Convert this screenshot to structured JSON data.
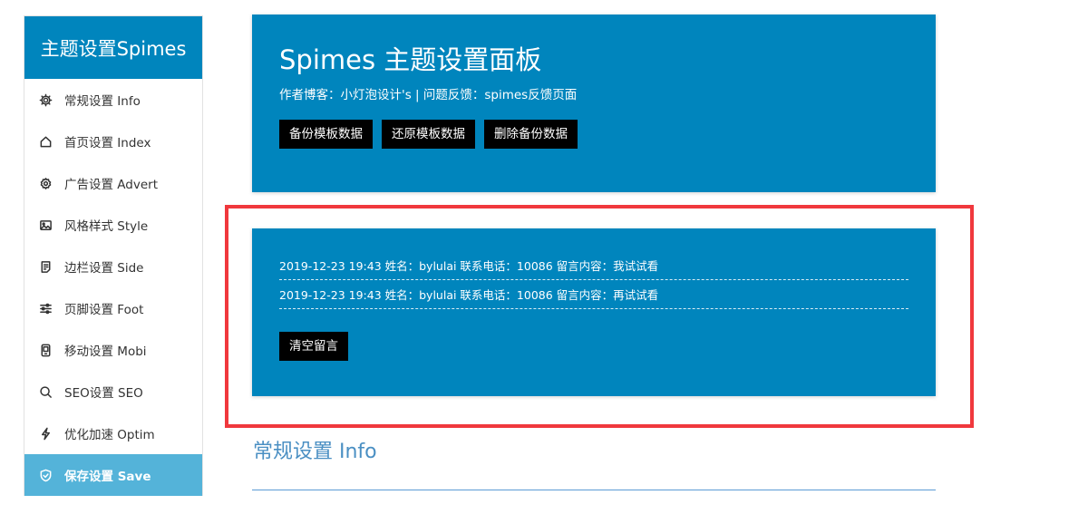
{
  "sidebar": {
    "title": "主题设置Spimes",
    "items": [
      {
        "label": "常规设置 Info",
        "icon": "gear-icon"
      },
      {
        "label": "首页设置 Index",
        "icon": "home-icon"
      },
      {
        "label": "广告设置 Advert",
        "icon": "settings-cog-icon"
      },
      {
        "label": "风格样式 Style",
        "icon": "image-icon"
      },
      {
        "label": "边栏设置 Side",
        "icon": "document-icon"
      },
      {
        "label": "页脚设置 Foot",
        "icon": "sliders-icon"
      },
      {
        "label": "移动设置 Mobi",
        "icon": "mobile-icon"
      },
      {
        "label": "SEO设置 SEO",
        "icon": "search-icon"
      },
      {
        "label": "优化加速 Optim",
        "icon": "lightning-icon"
      },
      {
        "label": "保存设置 Save",
        "icon": "shield-check-icon",
        "active": true
      }
    ]
  },
  "header_panel": {
    "title": "Spimes 主题设置面板",
    "subtitle": "作者博客：小灯泡设计's | 问题反馈：spimes反馈页面",
    "buttons": {
      "backup": "备份模板数据",
      "restore": "还原模板数据",
      "delete": "删除备份数据"
    }
  },
  "messages_panel": {
    "messages": [
      "2019-12-23 19:43 姓名：bylulai 联系电话：10086 留言内容：我试试看",
      "2019-12-23 19:43 姓名：bylulai 联系电话：10086 留言内容：再试试看"
    ],
    "clear_button": "清空留言"
  },
  "section": {
    "title": "常规设置 Info"
  },
  "colors": {
    "panel_bg": "#0085bd",
    "active_item_bg": "#54b3d9",
    "highlight_border": "#f0383d",
    "section_title": "#4a8fc3"
  }
}
